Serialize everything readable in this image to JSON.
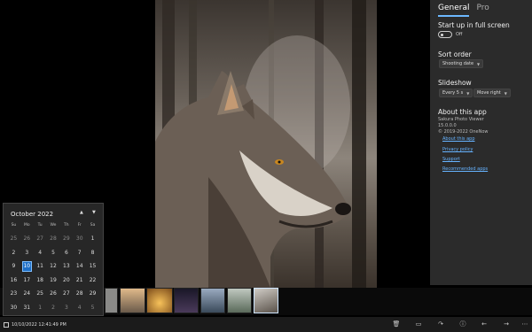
{
  "settings": {
    "tabs": [
      {
        "label": "General",
        "active": true
      },
      {
        "label": "Pro",
        "active": false
      }
    ],
    "startup_title": "Start up in full screen",
    "startup_toggle_text": "Off",
    "sort_title": "Sort order",
    "sort_value": "Shooting date",
    "slideshow_title": "Slideshow",
    "slideshow_interval": "Every 5 s",
    "slideshow_mode": "Move right",
    "about_title": "About this app",
    "about_lines": [
      "Sakura Photo Viewer",
      "15.0.0.0",
      "© 2019-2022 OneNow"
    ],
    "links": [
      "About this app",
      "Privacy policy",
      "Support",
      "Recommended apps"
    ],
    "accent": "#66b3ff"
  },
  "calendar": {
    "month": "October 2022",
    "nav_up": "▲",
    "nav_down": "▼",
    "weekdays": [
      "Su",
      "Mo",
      "Tu",
      "We",
      "Th",
      "Fr",
      "Sa"
    ],
    "days": [
      {
        "d": "25",
        "muted": true
      },
      {
        "d": "26",
        "muted": true
      },
      {
        "d": "27",
        "muted": true
      },
      {
        "d": "28",
        "muted": true
      },
      {
        "d": "29",
        "muted": true
      },
      {
        "d": "30",
        "muted": true
      },
      {
        "d": "1"
      },
      {
        "d": "2"
      },
      {
        "d": "3"
      },
      {
        "d": "4"
      },
      {
        "d": "5"
      },
      {
        "d": "6"
      },
      {
        "d": "7"
      },
      {
        "d": "8"
      },
      {
        "d": "9"
      },
      {
        "d": "10",
        "today": true
      },
      {
        "d": "11"
      },
      {
        "d": "12"
      },
      {
        "d": "13"
      },
      {
        "d": "14"
      },
      {
        "d": "15"
      },
      {
        "d": "16"
      },
      {
        "d": "17"
      },
      {
        "d": "18"
      },
      {
        "d": "19"
      },
      {
        "d": "20"
      },
      {
        "d": "21"
      },
      {
        "d": "22"
      },
      {
        "d": "23"
      },
      {
        "d": "24"
      },
      {
        "d": "25"
      },
      {
        "d": "26"
      },
      {
        "d": "27"
      },
      {
        "d": "28"
      },
      {
        "d": "29"
      },
      {
        "d": "30"
      },
      {
        "d": "31"
      },
      {
        "d": "1",
        "muted": true
      },
      {
        "d": "2",
        "muted": true
      },
      {
        "d": "3",
        "muted": true
      },
      {
        "d": "4",
        "muted": true
      },
      {
        "d": "5",
        "muted": true
      }
    ]
  },
  "filmstrip": {
    "thumbs": [
      {
        "color": "#8a8a88"
      },
      {
        "color": "#c08a52"
      },
      {
        "color": "#d68b2c"
      },
      {
        "color": "#2a2436"
      },
      {
        "color": "#5a6c8a"
      },
      {
        "color": "#8a9a8a"
      },
      {
        "color": "#6b6660",
        "selected": true
      }
    ]
  },
  "bottombar": {
    "datetime": "10/10/2022 12:41:49 PM",
    "tools": [
      "delete-icon",
      "slideshow-icon",
      "share-icon",
      "info-icon",
      "previous-icon",
      "next-icon",
      "more-icon"
    ]
  }
}
